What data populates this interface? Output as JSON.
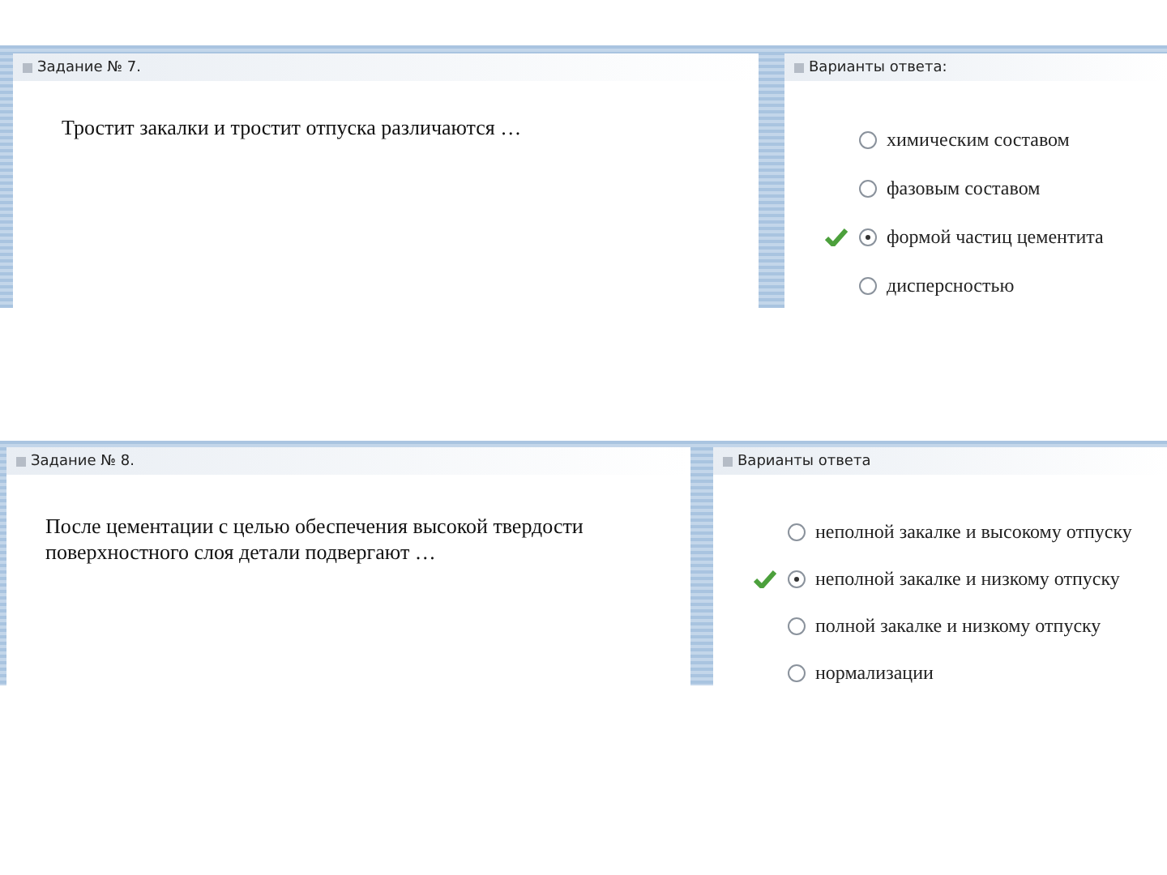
{
  "screens": [
    {
      "task": {
        "title": "Задание № 7.",
        "question": "Тростит закалки и тростит отпуска различаются …"
      },
      "answers": {
        "title": "Варианты ответа:",
        "options": [
          {
            "label": "химическим составом",
            "selected": false,
            "correct": false
          },
          {
            "label": "фазовым составом",
            "selected": false,
            "correct": false
          },
          {
            "label": "формой частиц цементита",
            "selected": true,
            "correct": true
          },
          {
            "label": "дисперсностью",
            "selected": false,
            "correct": false
          }
        ]
      }
    },
    {
      "task": {
        "title": "Задание № 8.",
        "question": "После цементации с целью обеспечения высокой твердости поверхностного слоя детали подвергают …"
      },
      "answers": {
        "title": "Варианты ответа",
        "options": [
          {
            "label": "неполной закалке и высокому отпуску",
            "selected": false,
            "correct": false
          },
          {
            "label": "неполной закалке и низкому отпуску",
            "selected": true,
            "correct": true
          },
          {
            "label": "полной закалке и низкому отпуску",
            "selected": false,
            "correct": false
          },
          {
            "label": "нормализации",
            "selected": false,
            "correct": false
          }
        ]
      }
    }
  ]
}
